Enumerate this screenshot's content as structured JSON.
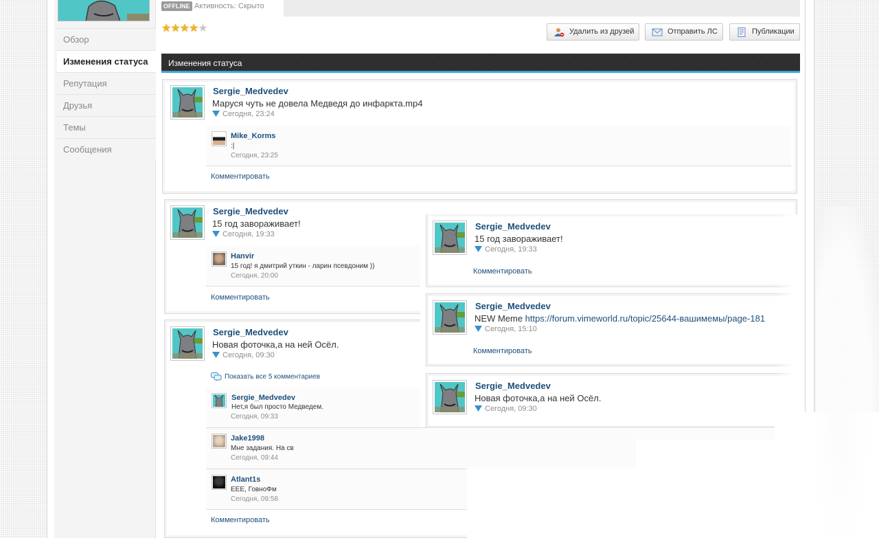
{
  "header": {
    "offline_badge": "OFFLINE",
    "activity": "Активность: Скрыто",
    "rating": {
      "value": 4,
      "max": 5
    }
  },
  "buttons": {
    "remove_friend": "Удалить из друзей",
    "send_pm": "Отправить ЛС",
    "publications": "Публикации"
  },
  "sidebar": {
    "items": [
      {
        "label": "Обзор"
      },
      {
        "label": "Изменения статуса",
        "active": true
      },
      {
        "label": "Репутация"
      },
      {
        "label": "Друзья"
      },
      {
        "label": "Темы"
      },
      {
        "label": "Сообщения"
      }
    ]
  },
  "section": {
    "title": "Изменения статуса"
  },
  "statuses": [
    {
      "author": "Sergie_Medvedev",
      "text": "Маруся чуть не довела Медведя до инфаркта.mp4",
      "time": "Сегодня, 23:24",
      "comments": [
        {
          "author": "Mike_Korms",
          "text": ":|",
          "time": "Сегодня, 23:25"
        }
      ],
      "comment_link": "Комментировать"
    },
    {
      "author": "Sergie_Medvedev",
      "text": "15 год завораживает!",
      "time": "Сегодня, 19:33",
      "comments": [
        {
          "author": "Hanvir",
          "text": "15 год! я дмитрий уткин - ларин псевдоним ))",
          "time": "Сегодня, 20:00"
        }
      ],
      "comment_link": "Комментировать"
    },
    {
      "author": "Sergie_Medvedev",
      "text": "Новая фоточка,а на ней Осёл.",
      "time": "Сегодня, 09:30",
      "show_all": "Показать все 5 комментариев",
      "comments": [
        {
          "author": "Sergie_Medvedev",
          "text": "Нет,я был просто Медведем.",
          "time": "Сегодня, 09:33"
        },
        {
          "author": "Jake1998",
          "text": "Мне задания. На св",
          "time": "Сегодня, 09:44"
        },
        {
          "author": "Atlant1s",
          "text": "ЕЕЕ, ГовноФм",
          "time": "Сегодня, 09:58"
        }
      ],
      "comment_link": "Комментировать"
    }
  ],
  "overlay_statuses": [
    {
      "author": "Sergie_Medvedev",
      "text": "15 год завораживает!",
      "time": "Сегодня, 19:33",
      "comment_link": "Комментировать"
    },
    {
      "author": "Sergie_Medvedev",
      "text_prefix": "NEW Meme ",
      "link": "https://forum.vimeworld.ru/topic/25644-вашимемы/page-181",
      "time": "Сегодня, 15:10",
      "comment_link": "Комментировать"
    },
    {
      "author": "Sergie_Medvedev",
      "text": "Новая фоточка,а на ней Осёл.",
      "time": "Сегодня, 09:30"
    }
  ],
  "colors": {
    "link": "#1d4f7c",
    "accent_bar": "#3aa3d8",
    "avatar_bg": "#51c6c6"
  }
}
